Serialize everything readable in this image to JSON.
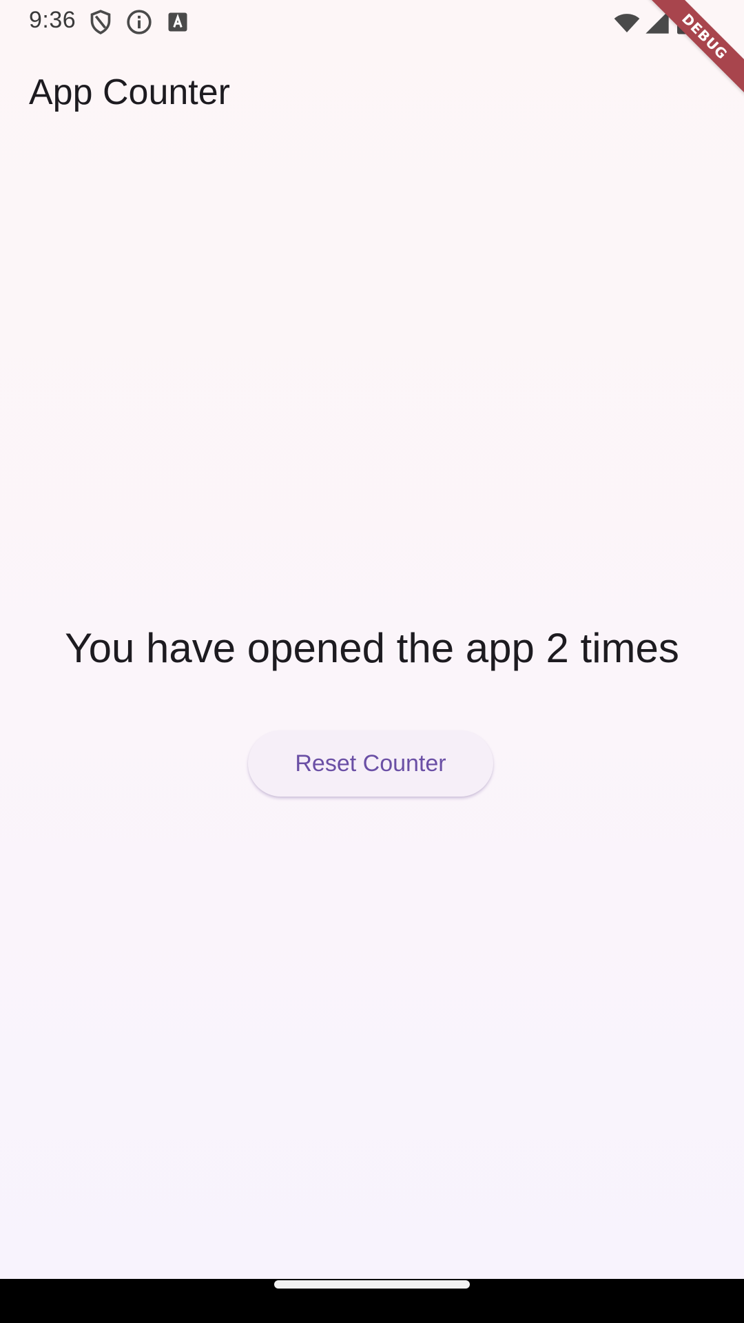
{
  "status_bar": {
    "time": "9:36",
    "left_icons": [
      "shield-icon",
      "info-icon",
      "a-notification-icon"
    ],
    "right_icons": [
      "wifi-icon",
      "cell-signal-icon",
      "battery-icon"
    ]
  },
  "debug_banner": {
    "label": "DEBUG",
    "color": "#a8454d"
  },
  "app_bar": {
    "title": "App Counter"
  },
  "main": {
    "message": "You have opened the app 2 times",
    "reset_button_label": "Reset Counter"
  },
  "colors": {
    "accent": "#6a4fa5",
    "background": "#fdf7f8"
  }
}
